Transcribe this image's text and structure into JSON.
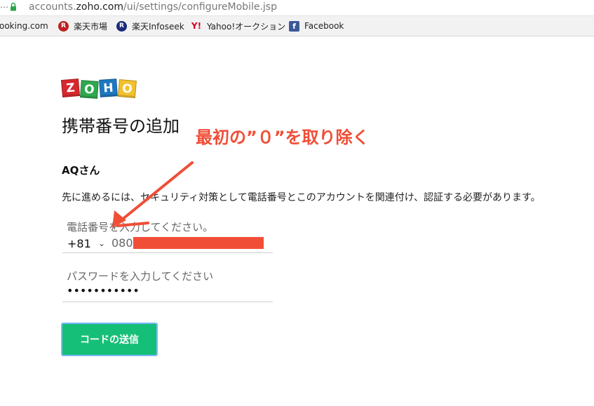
{
  "browser": {
    "url_prefix": "accounts.",
    "url_domain": "zoho.com",
    "url_path": "/ui/settings/configureMobile.jsp",
    "bookmarks": [
      {
        "label": "ooking.com",
        "icon": "booking-icon"
      },
      {
        "label": "楽天市場",
        "icon": "rakuten-icon",
        "glyph": "R"
      },
      {
        "label": "楽天Infoseek",
        "icon": "infoseek-icon",
        "glyph": "R"
      },
      {
        "label": "Yahoo!オークション",
        "icon": "yahoo-icon",
        "glyph": "Y!"
      },
      {
        "label": "Facebook",
        "icon": "facebook-icon",
        "glyph": "f"
      }
    ]
  },
  "logo": {
    "letters": [
      "Z",
      "O",
      "H",
      "O"
    ]
  },
  "page": {
    "title": "携帯番号の追加",
    "annotation": "最初の”０”を取り除く",
    "greeting": "AQさん",
    "description": "先に進めるには、セキュリティ対策として電話番号とこのアカウントを関連付け、認証する必要があります。"
  },
  "form": {
    "phone_label": "電話番号を入力してください。",
    "country_code": "+81",
    "phone_value": "080",
    "password_label": "パスワードを入力してください",
    "password_value": "•••••••••••",
    "submit_label": "コードの送信"
  },
  "colors": {
    "annotation": "#f04e37",
    "submit_bg": "#16bf77",
    "submit_border": "#7db8ff",
    "redaction": "#f04e37"
  }
}
